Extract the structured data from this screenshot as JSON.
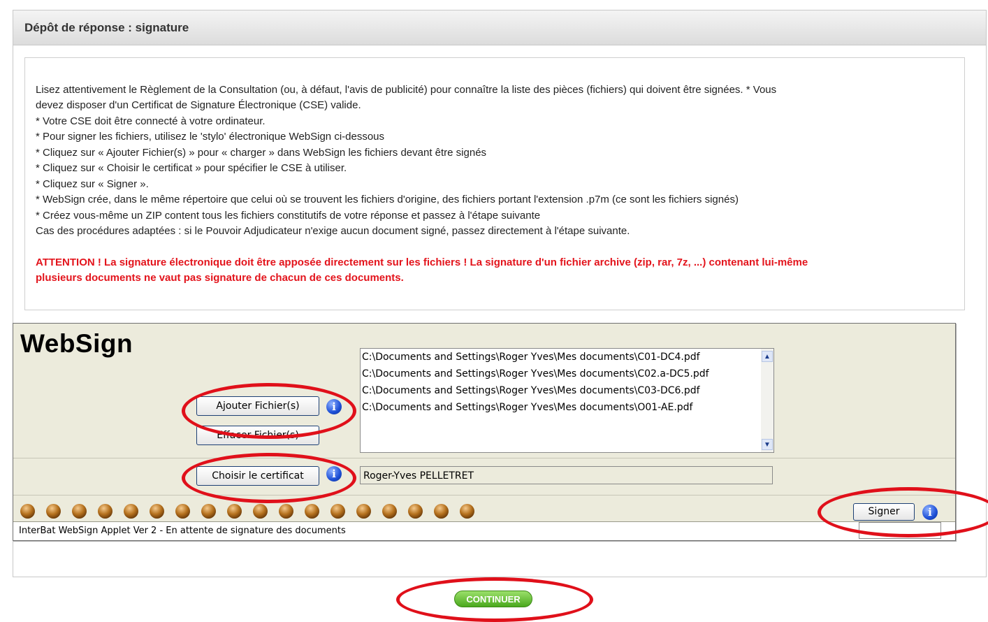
{
  "header": {
    "title": "Dépôt de réponse : signature"
  },
  "instructions": {
    "lines": [
      "Lisez attentivement le Règlement de la Consultation (ou, à défaut, l'avis de publicité) pour connaître la liste des pièces (fichiers) qui doivent être signées. * Vous",
      "devez disposer d'un Certificat de Signature Électronique (CSE) valide.",
      "* Votre CSE doit être connecté à votre ordinateur.",
      "* Pour signer les fichiers, utilisez le 'stylo' électronique WebSign ci-dessous",
      "* Cliquez sur « Ajouter Fichier(s) » pour « charger » dans WebSign les fichiers devant être signés",
      "* Cliquez sur « Choisir le certificat » pour spécifier le CSE à utiliser.",
      "* Cliquez sur « Signer ».",
      "* WebSign crée, dans le même répertoire que celui où se trouvent les fichiers d'origine, des fichiers portant l'extension .p7m (ce sont les fichiers signés)",
      "* Créez vous-même un ZIP content tous les fichiers constitutifs de votre réponse et passez à l'étape suivante",
      "Cas des procédures adaptées : si le Pouvoir Adjudicateur n'exige aucun document signé, passez directement à l'étape suivante."
    ],
    "warning_lines": [
      "ATTENTION ! La signature électronique doit être apposée directement sur les fichiers ! La signature d'un fichier archive (zip, rar, 7z, ...) contenant lui-même",
      "plusieurs documents ne vaut pas signature de chacun de ces documents."
    ]
  },
  "applet": {
    "logo": "WebSign",
    "add_files_label": "Ajouter Fichier(s)",
    "clear_files_label": "Effacer Fichier(s)",
    "choose_cert_label": "Choisir le certificat",
    "sign_label": "Signer",
    "info_icon": "i",
    "files": [
      "C:\\Documents and Settings\\Roger Yves\\Mes documents\\C01-DC4.pdf",
      "C:\\Documents and Settings\\Roger Yves\\Mes documents\\C02.a-DC5.pdf",
      "C:\\Documents and Settings\\Roger Yves\\Mes documents\\C03-DC6.pdf",
      "C:\\Documents and Settings\\Roger Yves\\Mes documents\\O01-AE.pdf"
    ],
    "certificate": "Roger-Yves PELLETRET",
    "status": "InterBat WebSign Applet Ver 2 - En attente de signature des documents",
    "progress_dots": 18,
    "scroll_up": "▲",
    "scroll_down": "▼"
  },
  "continue_label": "CONTINUER",
  "colors": {
    "warning": "#e3141c",
    "annotation": "#e0101a",
    "continue": "#4aa81d",
    "applet_bg": "#ecebdc"
  }
}
